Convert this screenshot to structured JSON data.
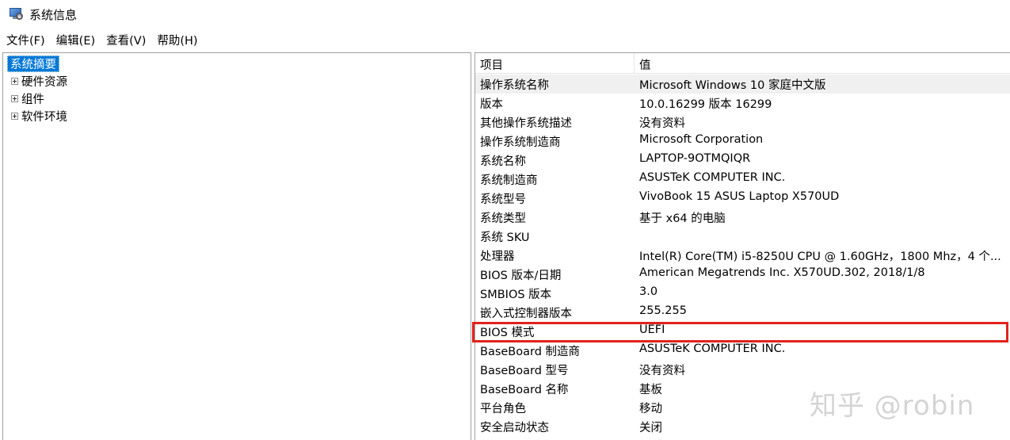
{
  "window": {
    "title": "系统信息",
    "icon": "system-info-icon"
  },
  "menu": [
    {
      "label": "文件(F)"
    },
    {
      "label": "编辑(E)"
    },
    {
      "label": "查看(V)"
    },
    {
      "label": "帮助(H)"
    }
  ],
  "tree": {
    "selected": "系统摘要",
    "items": [
      {
        "label": "硬件资源"
      },
      {
        "label": "组件"
      },
      {
        "label": "软件环境"
      }
    ]
  },
  "table": {
    "headers": {
      "item": "项目",
      "value": "值"
    },
    "rows": [
      {
        "item": "操作系统名称",
        "value": "Microsoft Windows 10 家庭中文版"
      },
      {
        "item": "版本",
        "value": "10.0.16299 版本 16299"
      },
      {
        "item": "其他操作系统描述",
        "value": "没有资料"
      },
      {
        "item": "操作系统制造商",
        "value": "Microsoft Corporation"
      },
      {
        "item": "系统名称",
        "value": "LAPTOP-9OTMQIQR"
      },
      {
        "item": "系统制造商",
        "value": "ASUSTeK COMPUTER INC."
      },
      {
        "item": "系统型号",
        "value": "VivoBook 15 ASUS Laptop X570UD"
      },
      {
        "item": "系统类型",
        "value": "基于 x64 的电脑"
      },
      {
        "item": "系统 SKU",
        "value": ""
      },
      {
        "item": "处理器",
        "value": "Intel(R) Core(TM) i5-8250U CPU @ 1.60GHz，1800 Mhz，4 个..."
      },
      {
        "item": "BIOS 版本/日期",
        "value": "American Megatrends Inc. X570UD.302, 2018/1/8"
      },
      {
        "item": "SMBIOS 版本",
        "value": "3.0"
      },
      {
        "item": "嵌入式控制器版本",
        "value": "255.255"
      },
      {
        "item": "BIOS 模式",
        "value": "UEFI"
      },
      {
        "item": "BaseBoard 制造商",
        "value": "ASUSTeK COMPUTER INC."
      },
      {
        "item": "BaseBoard 型号",
        "value": "没有资料"
      },
      {
        "item": "BaseBoard 名称",
        "value": "基板"
      },
      {
        "item": "平台角色",
        "value": "移动"
      },
      {
        "item": "安全启动状态",
        "value": "关闭"
      }
    ]
  },
  "annotation": {
    "color": "#e0231c"
  },
  "watermark": {
    "text": "知乎 @robin"
  }
}
